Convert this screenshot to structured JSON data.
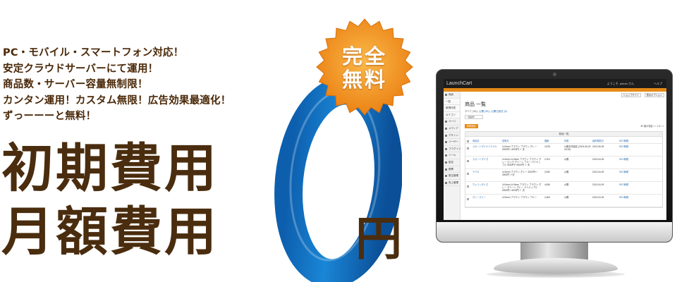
{
  "features": [
    "PC・モバイル・スマートフォン対応！",
    "安定クラウドサーバーにて運用！",
    "商品数・サーバー容量無制限！",
    "カンタン運用！カスタム無限！広告効果最適化！",
    "ずっーーーと無料！"
  ],
  "headline": {
    "line1": "初期費用",
    "line2": "月額費用"
  },
  "price": {
    "amount": "0",
    "unit": "円"
  },
  "badge": {
    "line1": "完全",
    "line2": "無料"
  },
  "colors": {
    "text_brown": "#4a2d0e",
    "zero_blue": "#1677c8",
    "badge_orange": "#f29a1f",
    "admin_accent": "#e58a17"
  },
  "screen": {
    "app_name": "LaunchCart",
    "user": "ようこそ, admin さん",
    "help": "ヘルプ",
    "sidebar": [
      "商品",
      "一覧",
      "新規作成",
      "カテゴリ",
      "ページ",
      "メディア",
      "デザイン",
      "ユーザー",
      "プラグイン",
      "ツール",
      "設定",
      "帳票",
      "受注管理",
      "売上管理"
    ],
    "buttons": [
      "ショップサイト",
      "表示オプション"
    ],
    "page_title": "商品 一覧",
    "filter": {
      "all": "すべて (30)",
      "published": "公開 (30)",
      "unpublished": "公開日設定 (0)"
    },
    "bulk_select": "一括操作",
    "new_button": "新規追加",
    "pager": "30 個の項目  « ‹ 1 /2 › »",
    "table": {
      "caption": "商品一覧",
      "headers": [
        "商品名",
        "説明文",
        "価格",
        "状態",
        "最終更新日",
        "SEO管理"
      ],
      "rows": [
        {
          "name": "スカートダイナミクナル",
          "desc": "14.5mm ブラウン ブラウン グレー 3000円〜4000円 ト 天",
          "price": "4,578",
          "status": "公開日未設定 (2013-06-29 18:16)",
          "date": "2013-06-09",
          "seo": "SEO管理"
        },
        {
          "name": "スカートダイズ",
          "desc": "14.5mm 14.5mm ブラウン ブラウン グレー ピンク グリーン ブルー パイナップル 3000円〜4000円 ト 天",
          "price": "4,761",
          "status": "公開",
          "date": "2013-04-09",
          "seo": "SEO管理"
        },
        {
          "name": "アイロ",
          "desc": "14.5mm ブラウン グレー 2000円〜3000円 ト天",
          "price": "2,630",
          "status": "公開",
          "date": "2013-04-09",
          "seo": "SEO管理"
        },
        {
          "name": "ウェリンタイズ",
          "desc": "14.5mm 14.5mm ブラウン ブラウン グレー グリーン グレー パイナップル 3000円〜4000円 ト 天",
          "price": "4,836",
          "status": "公開",
          "date": "2013-04-09",
          "seo": "SEO管理"
        },
        {
          "name": "グレースリー",
          "desc": "14.5mm ブラウン ブラウン ブルー",
          "price": "4,363",
          "status": "公開",
          "date": "2013-04-09",
          "seo": "SEO管理"
        }
      ]
    }
  }
}
